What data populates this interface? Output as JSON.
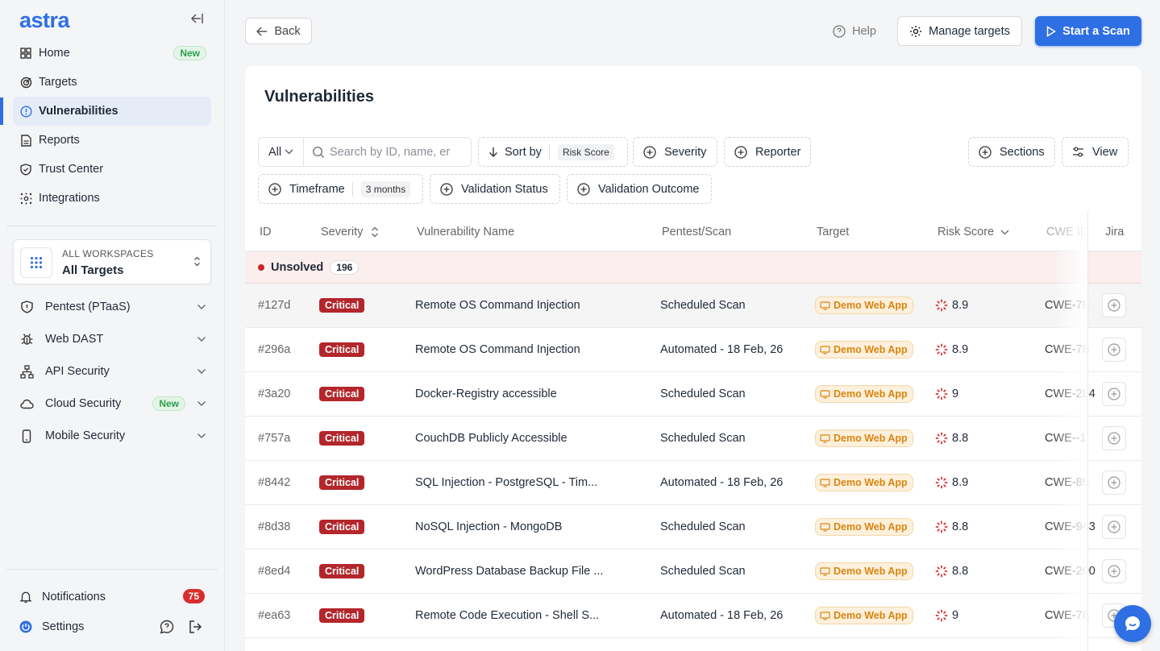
{
  "brand": {
    "logo": "astra"
  },
  "sidebar": {
    "nav": [
      {
        "label": "Home",
        "icon": "home-grid-icon",
        "badge": "New"
      },
      {
        "label": "Targets",
        "icon": "target-icon"
      },
      {
        "label": "Vulnerabilities",
        "icon": "alert-circle-icon",
        "active": true
      },
      {
        "label": "Reports",
        "icon": "report-icon"
      },
      {
        "label": "Trust Center",
        "icon": "shield-icon"
      },
      {
        "label": "Integrations",
        "icon": "integrations-icon"
      }
    ],
    "workspace": {
      "label": "ALL WORKSPACES",
      "value": "All Targets"
    },
    "groups": [
      {
        "label": "Pentest (PTaaS)",
        "icon": "shield-check-icon"
      },
      {
        "label": "Web DAST",
        "icon": "bug-icon"
      },
      {
        "label": "API Security",
        "icon": "api-icon"
      },
      {
        "label": "Cloud Security",
        "icon": "cloud-icon",
        "badge": "New"
      },
      {
        "label": "Mobile Security",
        "icon": "mobile-icon"
      }
    ],
    "notifications": {
      "label": "Notifications",
      "count": "75"
    },
    "settings": {
      "label": "Settings"
    }
  },
  "topbar": {
    "back": "Back",
    "help": "Help",
    "manage_targets": "Manage targets",
    "start_scan": "Start a Scan"
  },
  "page": {
    "title": "Vulnerabilities"
  },
  "filters": {
    "scope": "All",
    "search_placeholder": "Search by ID, name, er",
    "sort_by": "Sort by",
    "sort_value": "Risk Score",
    "severity": "Severity",
    "reporter": "Reporter",
    "sections": "Sections",
    "view": "View",
    "timeframe": "Timeframe",
    "timeframe_value": "3 months",
    "validation_status": "Validation Status",
    "validation_outcome": "Validation Outcome"
  },
  "table": {
    "columns": [
      "ID",
      "Severity",
      "Vulnerability Name",
      "Pentest/Scan",
      "Target",
      "Risk Score",
      "CWE ID",
      "Jira"
    ],
    "group": {
      "label": "Unsolved",
      "count": "196"
    },
    "rows": [
      {
        "id": "#127d",
        "severity": "Critical",
        "name": "Remote OS Command Injection",
        "scan": "Scheduled Scan",
        "target": "Demo Web App",
        "risk": "8.9",
        "cwe": "CWE-78"
      },
      {
        "id": "#296a",
        "severity": "Critical",
        "name": "Remote OS Command Injection",
        "scan": "Automated - 18 Feb, 26",
        "target": "Demo Web App",
        "risk": "8.9",
        "cwe": "CWE-78"
      },
      {
        "id": "#3a20",
        "severity": "Critical",
        "name": "Docker-Registry accessible",
        "scan": "Scheduled Scan",
        "target": "Demo Web App",
        "risk": "9",
        "cwe": "CWE-284"
      },
      {
        "id": "#757a",
        "severity": "Critical",
        "name": "CouchDB Publicly Accessible",
        "scan": "Scheduled Scan",
        "target": "Demo Web App",
        "risk": "8.8",
        "cwe": "CWE--1"
      },
      {
        "id": "#8442",
        "severity": "Critical",
        "name": "SQL Injection - PostgreSQL - Tim...",
        "scan": "Automated - 18 Feb, 26",
        "target": "Demo Web App",
        "risk": "8.9",
        "cwe": "CWE-89"
      },
      {
        "id": "#8d38",
        "severity": "Critical",
        "name": "NoSQL Injection - MongoDB",
        "scan": "Scheduled Scan",
        "target": "Demo Web App",
        "risk": "8.8",
        "cwe": "CWE-943"
      },
      {
        "id": "#8ed4",
        "severity": "Critical",
        "name": "WordPress Database Backup File ...",
        "scan": "Scheduled Scan",
        "target": "Demo Web App",
        "risk": "8.8",
        "cwe": "CWE-200"
      },
      {
        "id": "#ea63",
        "severity": "Critical",
        "name": "Remote Code Execution - Shell S...",
        "scan": "Automated - 18 Feb, 26",
        "target": "Demo Web App",
        "risk": "9",
        "cwe": "CWE-78"
      }
    ]
  },
  "colors": {
    "accent": "#2f6fe4",
    "critical": "#b3262b",
    "target_tag": "#d88512"
  }
}
